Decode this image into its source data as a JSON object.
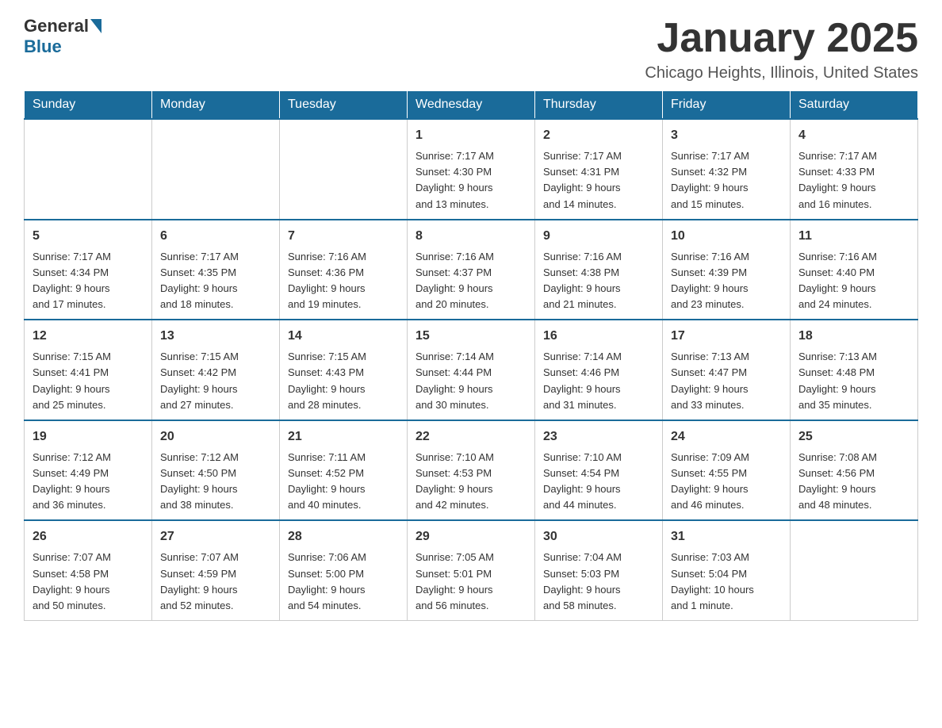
{
  "header": {
    "logo_text_general": "General",
    "logo_text_blue": "Blue",
    "title": "January 2025",
    "subtitle": "Chicago Heights, Illinois, United States"
  },
  "days_of_week": [
    "Sunday",
    "Monday",
    "Tuesday",
    "Wednesday",
    "Thursday",
    "Friday",
    "Saturday"
  ],
  "weeks": [
    [
      {
        "day": "",
        "info": ""
      },
      {
        "day": "",
        "info": ""
      },
      {
        "day": "",
        "info": ""
      },
      {
        "day": "1",
        "info": "Sunrise: 7:17 AM\nSunset: 4:30 PM\nDaylight: 9 hours\nand 13 minutes."
      },
      {
        "day": "2",
        "info": "Sunrise: 7:17 AM\nSunset: 4:31 PM\nDaylight: 9 hours\nand 14 minutes."
      },
      {
        "day": "3",
        "info": "Sunrise: 7:17 AM\nSunset: 4:32 PM\nDaylight: 9 hours\nand 15 minutes."
      },
      {
        "day": "4",
        "info": "Sunrise: 7:17 AM\nSunset: 4:33 PM\nDaylight: 9 hours\nand 16 minutes."
      }
    ],
    [
      {
        "day": "5",
        "info": "Sunrise: 7:17 AM\nSunset: 4:34 PM\nDaylight: 9 hours\nand 17 minutes."
      },
      {
        "day": "6",
        "info": "Sunrise: 7:17 AM\nSunset: 4:35 PM\nDaylight: 9 hours\nand 18 minutes."
      },
      {
        "day": "7",
        "info": "Sunrise: 7:16 AM\nSunset: 4:36 PM\nDaylight: 9 hours\nand 19 minutes."
      },
      {
        "day": "8",
        "info": "Sunrise: 7:16 AM\nSunset: 4:37 PM\nDaylight: 9 hours\nand 20 minutes."
      },
      {
        "day": "9",
        "info": "Sunrise: 7:16 AM\nSunset: 4:38 PM\nDaylight: 9 hours\nand 21 minutes."
      },
      {
        "day": "10",
        "info": "Sunrise: 7:16 AM\nSunset: 4:39 PM\nDaylight: 9 hours\nand 23 minutes."
      },
      {
        "day": "11",
        "info": "Sunrise: 7:16 AM\nSunset: 4:40 PM\nDaylight: 9 hours\nand 24 minutes."
      }
    ],
    [
      {
        "day": "12",
        "info": "Sunrise: 7:15 AM\nSunset: 4:41 PM\nDaylight: 9 hours\nand 25 minutes."
      },
      {
        "day": "13",
        "info": "Sunrise: 7:15 AM\nSunset: 4:42 PM\nDaylight: 9 hours\nand 27 minutes."
      },
      {
        "day": "14",
        "info": "Sunrise: 7:15 AM\nSunset: 4:43 PM\nDaylight: 9 hours\nand 28 minutes."
      },
      {
        "day": "15",
        "info": "Sunrise: 7:14 AM\nSunset: 4:44 PM\nDaylight: 9 hours\nand 30 minutes."
      },
      {
        "day": "16",
        "info": "Sunrise: 7:14 AM\nSunset: 4:46 PM\nDaylight: 9 hours\nand 31 minutes."
      },
      {
        "day": "17",
        "info": "Sunrise: 7:13 AM\nSunset: 4:47 PM\nDaylight: 9 hours\nand 33 minutes."
      },
      {
        "day": "18",
        "info": "Sunrise: 7:13 AM\nSunset: 4:48 PM\nDaylight: 9 hours\nand 35 minutes."
      }
    ],
    [
      {
        "day": "19",
        "info": "Sunrise: 7:12 AM\nSunset: 4:49 PM\nDaylight: 9 hours\nand 36 minutes."
      },
      {
        "day": "20",
        "info": "Sunrise: 7:12 AM\nSunset: 4:50 PM\nDaylight: 9 hours\nand 38 minutes."
      },
      {
        "day": "21",
        "info": "Sunrise: 7:11 AM\nSunset: 4:52 PM\nDaylight: 9 hours\nand 40 minutes."
      },
      {
        "day": "22",
        "info": "Sunrise: 7:10 AM\nSunset: 4:53 PM\nDaylight: 9 hours\nand 42 minutes."
      },
      {
        "day": "23",
        "info": "Sunrise: 7:10 AM\nSunset: 4:54 PM\nDaylight: 9 hours\nand 44 minutes."
      },
      {
        "day": "24",
        "info": "Sunrise: 7:09 AM\nSunset: 4:55 PM\nDaylight: 9 hours\nand 46 minutes."
      },
      {
        "day": "25",
        "info": "Sunrise: 7:08 AM\nSunset: 4:56 PM\nDaylight: 9 hours\nand 48 minutes."
      }
    ],
    [
      {
        "day": "26",
        "info": "Sunrise: 7:07 AM\nSunset: 4:58 PM\nDaylight: 9 hours\nand 50 minutes."
      },
      {
        "day": "27",
        "info": "Sunrise: 7:07 AM\nSunset: 4:59 PM\nDaylight: 9 hours\nand 52 minutes."
      },
      {
        "day": "28",
        "info": "Sunrise: 7:06 AM\nSunset: 5:00 PM\nDaylight: 9 hours\nand 54 minutes."
      },
      {
        "day": "29",
        "info": "Sunrise: 7:05 AM\nSunset: 5:01 PM\nDaylight: 9 hours\nand 56 minutes."
      },
      {
        "day": "30",
        "info": "Sunrise: 7:04 AM\nSunset: 5:03 PM\nDaylight: 9 hours\nand 58 minutes."
      },
      {
        "day": "31",
        "info": "Sunrise: 7:03 AM\nSunset: 5:04 PM\nDaylight: 10 hours\nand 1 minute."
      },
      {
        "day": "",
        "info": ""
      }
    ]
  ]
}
